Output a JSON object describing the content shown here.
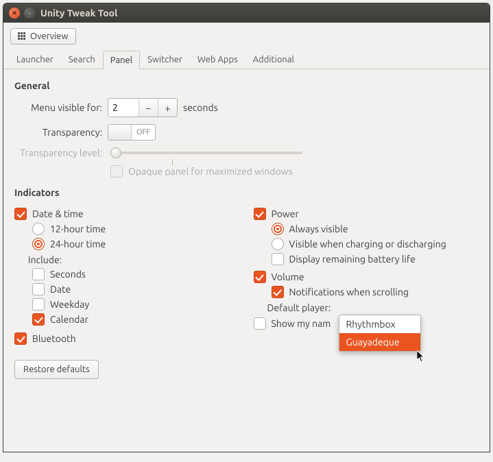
{
  "window": {
    "title": "Unity Tweak Tool"
  },
  "toolbar": {
    "overview": "Overview"
  },
  "tabs": [
    "Launcher",
    "Search",
    "Panel",
    "Switcher",
    "Web Apps",
    "Additional"
  ],
  "active_tab": "Panel",
  "general": {
    "heading": "General",
    "menu_visible_label": "Menu visible for:",
    "menu_visible_value": "2",
    "seconds": "seconds",
    "transparency_label": "Transparency:",
    "transparency_state": "OFF",
    "transparency_level_label": "Transparency level:",
    "opaque_label": "Opaque panel for maximized windows"
  },
  "indicators": {
    "heading": "Indicators",
    "left": {
      "datetime": "Date & time",
      "twelve": "12-hour time",
      "twentyfour": "24-hour time",
      "include": "Include:",
      "seconds": "Seconds",
      "date": "Date",
      "weekday": "Weekday",
      "calendar": "Calendar",
      "bluetooth": "Bluetooth"
    },
    "right": {
      "power": "Power",
      "always": "Always visible",
      "charging": "Visible when charging or discharging",
      "remaining": "Display remaining battery life",
      "volume": "Volume",
      "notifications": "Notifications when scrolling",
      "default_player_label": "Default player:",
      "show_name": "Show my nam"
    }
  },
  "dropdown": {
    "options": [
      "Rhythmbox",
      "Guayadeque"
    ],
    "selected": "Guayadeque"
  },
  "footer": {
    "restore": "Restore defaults"
  }
}
